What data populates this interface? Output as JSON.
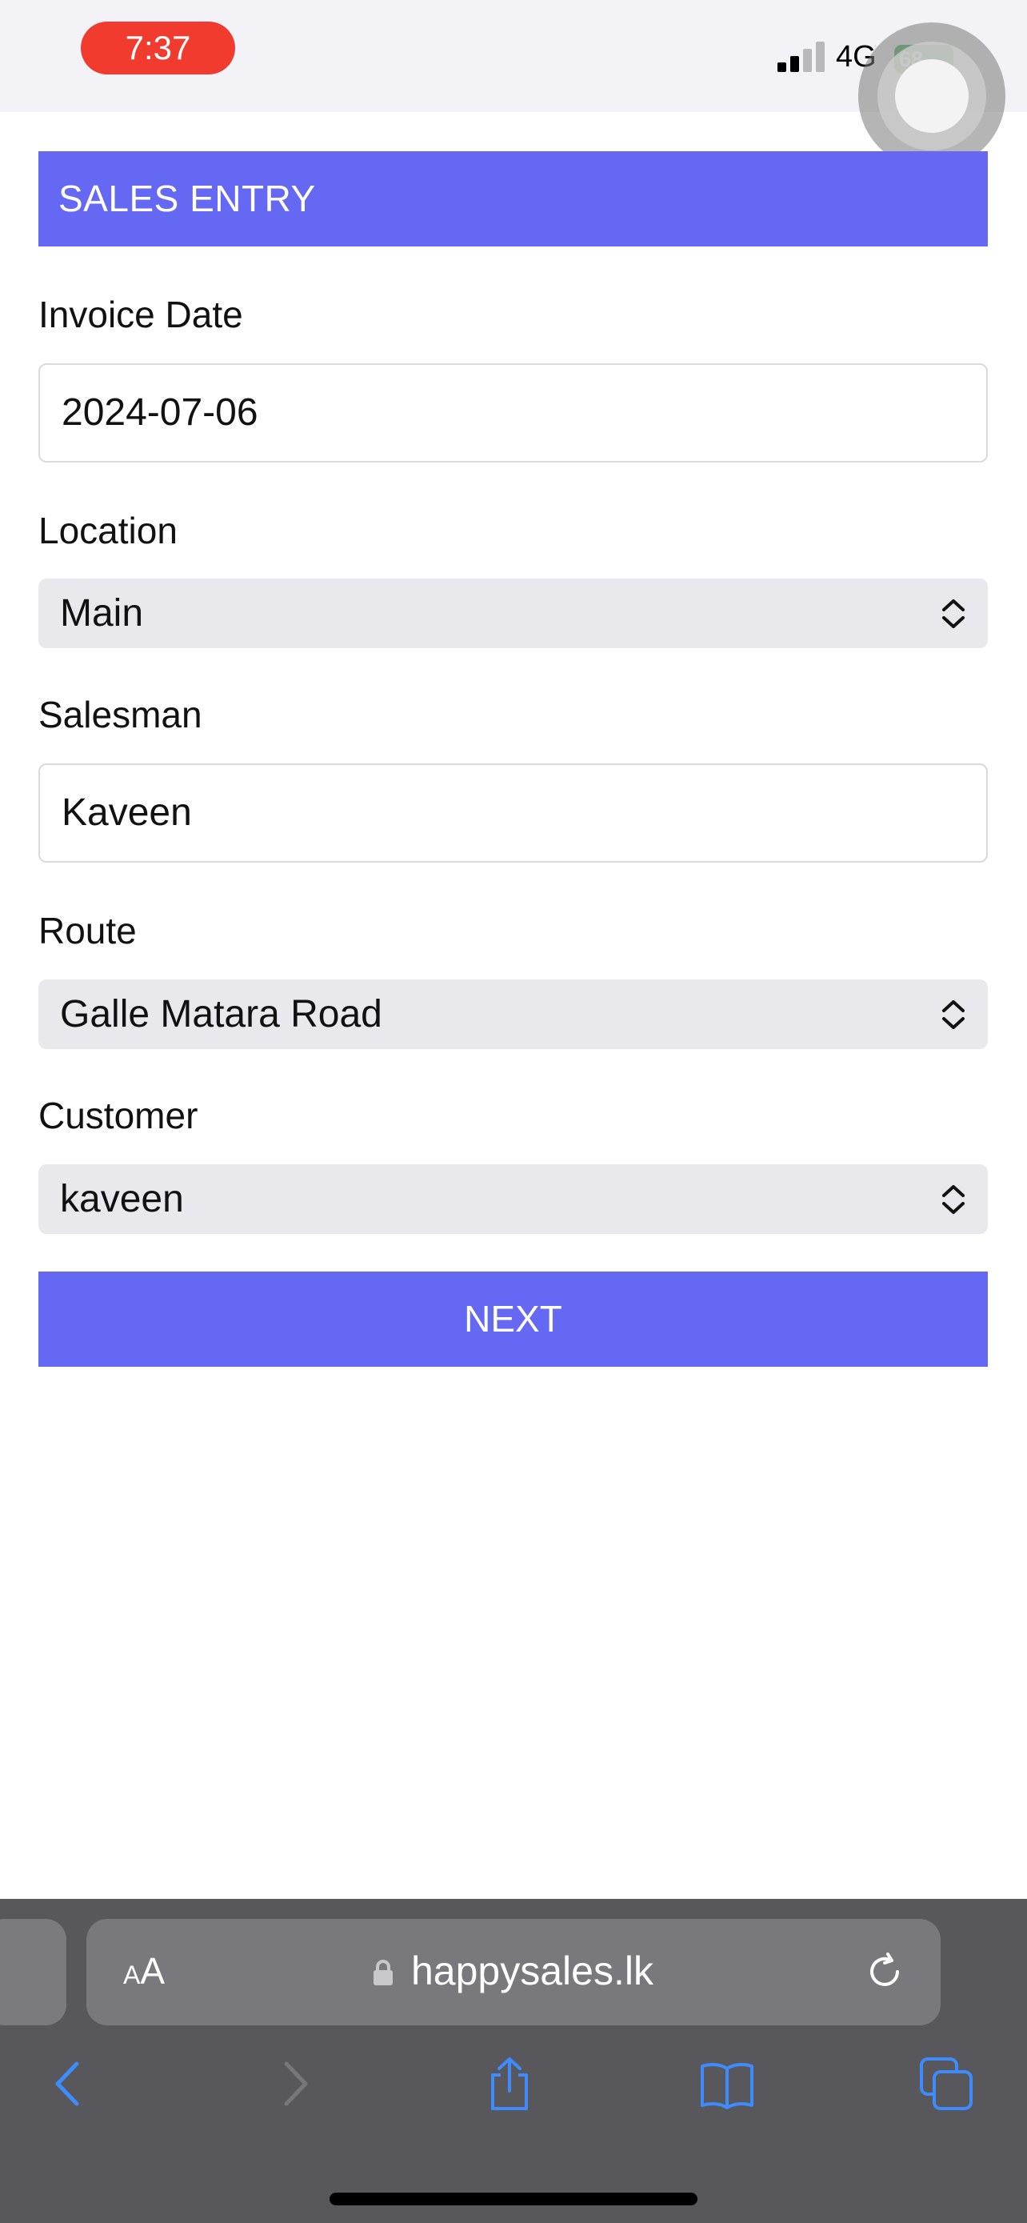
{
  "status_bar": {
    "time": "7:37",
    "network": "4G",
    "battery": "68"
  },
  "page": {
    "header_title": "SALES ENTRY",
    "fields": {
      "invoice_date": {
        "label": "Invoice Date",
        "value": "2024-07-06"
      },
      "location": {
        "label": "Location",
        "value": "Main"
      },
      "salesman": {
        "label": "Salesman",
        "value": "Kaveen"
      },
      "route": {
        "label": "Route",
        "value": "Galle Matara Road"
      },
      "customer": {
        "label": "Customer",
        "value": "kaveen"
      }
    },
    "next_label": "NEXT",
    "accent_color": "#6568f3"
  },
  "browser": {
    "text_size_small": "A",
    "text_size_large": "A",
    "url": "happysales.lk",
    "icons": [
      "lock-icon",
      "reload-icon",
      "back-icon",
      "forward-icon",
      "share-icon",
      "bookmarks-icon",
      "tabs-icon"
    ]
  }
}
